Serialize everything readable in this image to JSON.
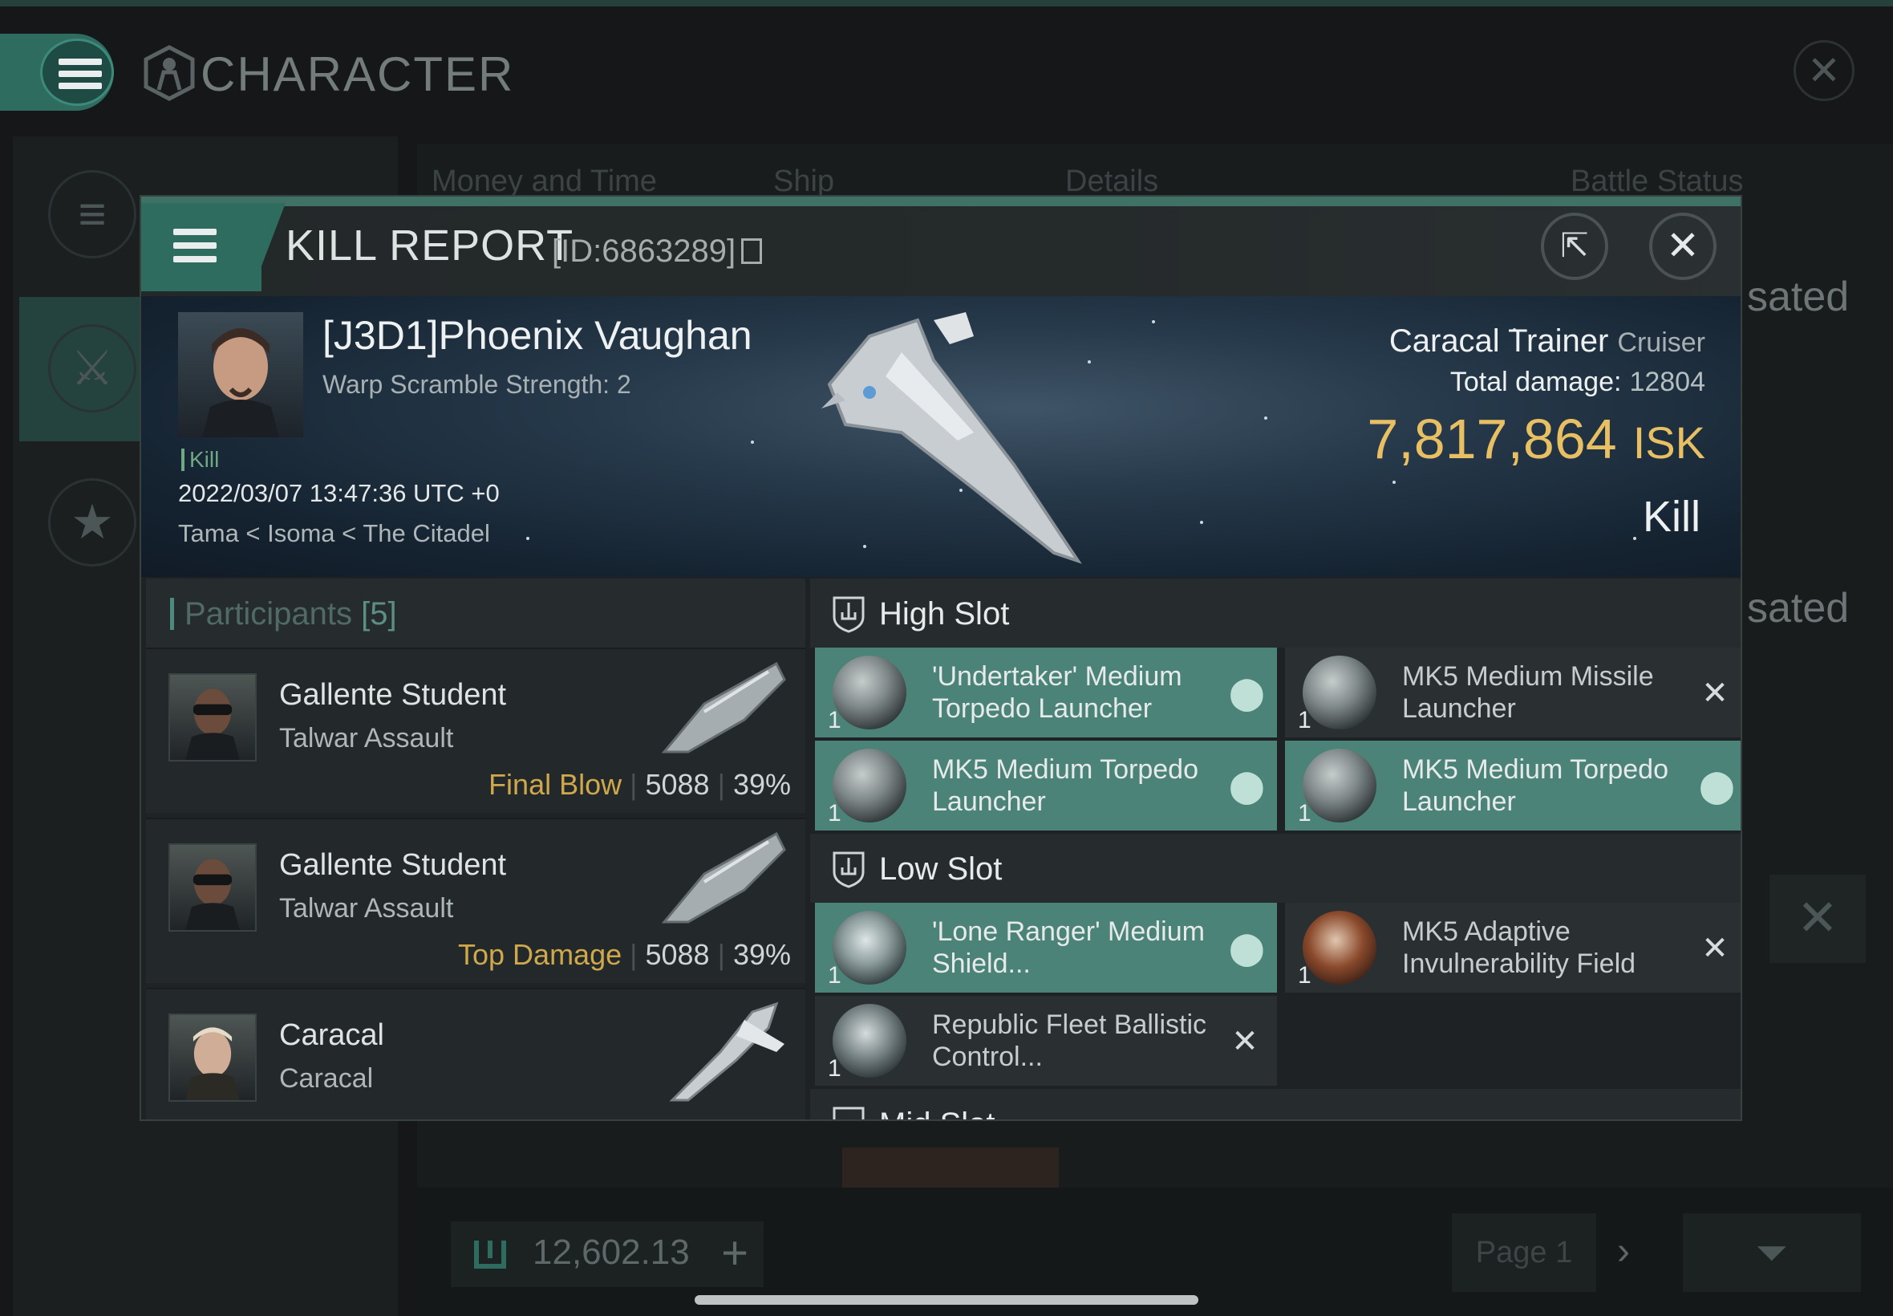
{
  "background": {
    "title": "CHARACTER",
    "column_headers": [
      "Money and Time",
      "Ship",
      "Details",
      "Battle Status"
    ],
    "status_fragments": [
      "sated",
      "sated"
    ],
    "currency": "12,602.13",
    "page": "Page 1"
  },
  "kill_report": {
    "title": "KILL REPORT",
    "id": "[ID:6863289]",
    "victim": {
      "name": "[J3D1]Phoenix Vaughan",
      "warp_scramble": "Warp Scramble Strength: 2",
      "kill_tag": "Kill",
      "time": "2022/03/07 13:47:36 UTC +0",
      "location": "Tama < Isoma < The Citadel"
    },
    "ship": {
      "name": "Caracal Trainer",
      "class": "Cruiser",
      "total_damage_label": "Total damage:",
      "total_damage": "12804",
      "isk_value": "7,817,864",
      "isk_unit": "ISK",
      "result": "Kill"
    },
    "participants": {
      "label": "Participants",
      "count": "[5]",
      "items": [
        {
          "name": "Gallente Student",
          "ship": "Talwar Assault",
          "tag": "Final Blow",
          "damage": "5088",
          "percent": "39%"
        },
        {
          "name": "Gallente Student",
          "ship": "Talwar Assault",
          "tag": "Top Damage",
          "damage": "5088",
          "percent": "39%"
        },
        {
          "name": "Caracal",
          "ship": "Caracal",
          "tag": "",
          "damage": "",
          "percent": ""
        }
      ]
    },
    "fitting": {
      "high_slot_label": "High Slot",
      "low_slot_label": "Low Slot",
      "mid_slot_label": "Mid Slot",
      "high": [
        {
          "qty": "1",
          "name": "'Undertaker' Medium Torpedo Launcher",
          "state": "dropped"
        },
        {
          "qty": "1",
          "name": "MK5 Medium Missile Launcher",
          "state": "destroyed"
        },
        {
          "qty": "1",
          "name": "MK5 Medium Torpedo Launcher",
          "state": "dropped"
        },
        {
          "qty": "1",
          "name": "MK5 Medium Torpedo Launcher",
          "state": "dropped"
        }
      ],
      "low": [
        {
          "qty": "1",
          "name": "'Lone Ranger' Medium Shield...",
          "state": "dropped"
        },
        {
          "qty": "1",
          "name": "MK5 Adaptive Invulnerability Field",
          "state": "destroyed"
        },
        {
          "qty": "1",
          "name": "Republic Fleet Ballistic Control...",
          "state": "destroyed"
        }
      ]
    }
  },
  "colors": {
    "accent": "#4b8378",
    "isk": "#e8bf63",
    "final_blow": "#d0a84c"
  }
}
